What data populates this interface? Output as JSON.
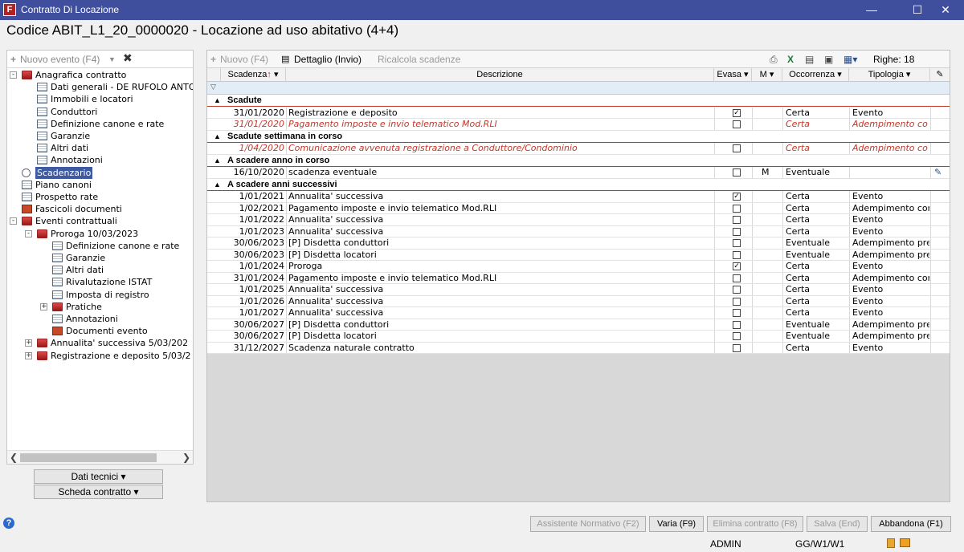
{
  "window": {
    "title": "Contratto Di Locazione",
    "app_icon": "F"
  },
  "header": {
    "title": "Codice ABIT_L1_20_0000020 - Locazione ad uso abitativo (4+4)"
  },
  "left_toolbar": {
    "new_event": "Nuovo evento (F4)"
  },
  "tree": [
    "Anagrafica contratto",
    "Dati generali - DE RUFOLO ANTO",
    "Immobili e locatori",
    "Conduttori",
    "Definizione canone e rate",
    "Garanzie",
    "Altri dati",
    "Annotazioni",
    "Scadenzario",
    "Piano canoni",
    "Prospetto rate",
    "Fascicoli documenti",
    "Eventi contrattuali",
    "Proroga 10/03/2023",
    "Definizione canone e rate",
    "Garanzie",
    "Altri dati",
    "Rivalutazione ISTAT",
    "Imposta di registro",
    "Pratiche",
    "Annotazioni",
    "Documenti evento",
    "Annualita' successiva  5/03/202",
    "Registrazione e deposito  5/03/2"
  ],
  "left_buttons": {
    "dati_tecnici": "Dati tecnici",
    "scheda_contratto": "Scheda contratto"
  },
  "grid_toolbar": {
    "nuovo": "Nuovo (F4)",
    "dettaglio": "Dettaglio (Invio)",
    "ricalcola": "Ricalcola scadenze",
    "righe": "Righe: 18"
  },
  "columns": {
    "scadenza": "Scadenza",
    "descrizione": "Descrizione",
    "evasa": "Evasa",
    "m": "M",
    "occorrenza": "Occorrenza",
    "tipologia": "Tipologia"
  },
  "groups": [
    "Scadute",
    "Scadute settimana in corso",
    "A scadere anno in corso",
    "A scadere anni successivi"
  ],
  "rows": [
    {
      "d": "31/01/2020",
      "desc": "Registrazione e deposito",
      "ev": "✓",
      "m": "",
      "occ": "Certa",
      "tip": "Evento"
    },
    {
      "d": "31/01/2020",
      "desc": "Pagamento imposte e invio telematico Mod.RLI",
      "ev": "",
      "m": "",
      "occ": "Certa",
      "tip": "Adempimento co"
    },
    {
      "d": "1/04/2020",
      "desc": "Comunicazione avvenuta registrazione a Conduttore/Condominio",
      "ev": "",
      "m": "",
      "occ": "Certa",
      "tip": "Adempimento co"
    },
    {
      "d": "16/10/2020",
      "desc": "scadenza eventuale",
      "ev": "",
      "m": "M",
      "occ": "Eventuale",
      "tip": ""
    },
    {
      "d": "1/01/2021",
      "desc": "Annualita' successiva",
      "ev": "✓",
      "m": "",
      "occ": "Certa",
      "tip": "Evento"
    },
    {
      "d": "1/02/2021",
      "desc": "Pagamento imposte e invio telematico Mod.RLI",
      "ev": "",
      "m": "",
      "occ": "Certa",
      "tip": "Adempimento cor"
    },
    {
      "d": "1/01/2022",
      "desc": "Annualita' successiva",
      "ev": "",
      "m": "",
      "occ": "Certa",
      "tip": "Evento"
    },
    {
      "d": "1/01/2023",
      "desc": "Annualita' successiva",
      "ev": "",
      "m": "",
      "occ": "Certa",
      "tip": "Evento"
    },
    {
      "d": "30/06/2023",
      "desc": "[P] Disdetta conduttori",
      "ev": "",
      "m": "",
      "occ": "Eventuale",
      "tip": "Adempimento pre"
    },
    {
      "d": "30/06/2023",
      "desc": "[P] Disdetta locatori",
      "ev": "",
      "m": "",
      "occ": "Eventuale",
      "tip": "Adempimento pre"
    },
    {
      "d": "1/01/2024",
      "desc": "Proroga",
      "ev": "✓",
      "m": "",
      "occ": "Certa",
      "tip": "Evento"
    },
    {
      "d": "31/01/2024",
      "desc": "Pagamento imposte e invio telematico Mod.RLI",
      "ev": "",
      "m": "",
      "occ": "Certa",
      "tip": "Adempimento cor"
    },
    {
      "d": "1/01/2025",
      "desc": "Annualita' successiva",
      "ev": "",
      "m": "",
      "occ": "Certa",
      "tip": "Evento"
    },
    {
      "d": "1/01/2026",
      "desc": "Annualita' successiva",
      "ev": "",
      "m": "",
      "occ": "Certa",
      "tip": "Evento"
    },
    {
      "d": "1/01/2027",
      "desc": "Annualita' successiva",
      "ev": "",
      "m": "",
      "occ": "Certa",
      "tip": "Evento"
    },
    {
      "d": "30/06/2027",
      "desc": "[P] Disdetta conduttori",
      "ev": "",
      "m": "",
      "occ": "Eventuale",
      "tip": "Adempimento pre"
    },
    {
      "d": "30/06/2027",
      "desc": "[P] Disdetta locatori",
      "ev": "",
      "m": "",
      "occ": "Eventuale",
      "tip": "Adempimento pre"
    },
    {
      "d": "31/12/2027",
      "desc": "Scadenza naturale contratto",
      "ev": "",
      "m": "",
      "occ": "Certa",
      "tip": "Evento"
    }
  ],
  "bottom_buttons": {
    "assistente": "Assistente Normativo (F2)",
    "varia": "Varia (F9)",
    "elimina": "Elimina contratto (F8)",
    "salva": "Salva (End)",
    "abbandona": "Abbandona (F1)"
  },
  "status": {
    "user": "ADMIN",
    "code": "GG/W1/W1"
  },
  "colors": {
    "titlebar": "#3f4f9e",
    "accent_red": "#c0392b",
    "selection": "#3f5aa0"
  }
}
